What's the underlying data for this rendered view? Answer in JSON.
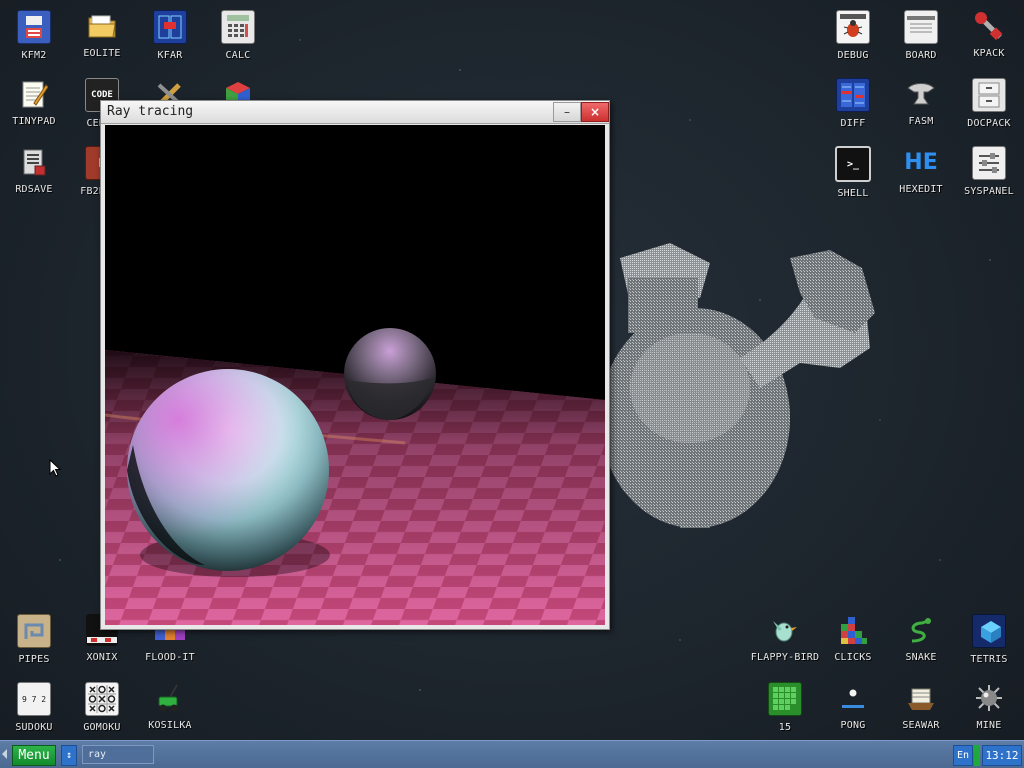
{
  "desktop": {
    "icons_left": [
      {
        "label": "KFM2",
        "icon": "floppy-disk-icon"
      },
      {
        "label": "EOLITE",
        "icon": "folder-icon"
      },
      {
        "label": "KFAR",
        "icon": "file-manager-icon"
      },
      {
        "label": "CALC",
        "icon": "calculator-icon"
      },
      {
        "label": "TINYPAD",
        "icon": "notepad-icon"
      },
      {
        "label": "CEDIT",
        "icon": "code-editor-icon"
      },
      {
        "label": "",
        "icon": "tools-icon"
      },
      {
        "label": "",
        "icon": "cube-icon"
      },
      {
        "label": "RDSAVE",
        "icon": "ramdisk-save-icon"
      },
      {
        "label": "FB2READ",
        "icon": "book-icon"
      }
    ],
    "icons_right": [
      {
        "label": "DEBUG",
        "icon": "bug-icon"
      },
      {
        "label": "BOARD",
        "icon": "board-icon"
      },
      {
        "label": "KPACK",
        "icon": "wrench-icon"
      },
      {
        "label": "DIFF",
        "icon": "diff-icon"
      },
      {
        "label": "FASM",
        "icon": "anvil-icon"
      },
      {
        "label": "DOCPACK",
        "icon": "cabinet-icon"
      },
      {
        "label": "SHELL",
        "icon": "terminal-icon"
      },
      {
        "label": "HEXEDIT",
        "icon": "hex-icon"
      },
      {
        "label": "SYSPANEL",
        "icon": "sliders-icon"
      }
    ],
    "icons_bottom_left": [
      {
        "label": "PIPES",
        "icon": "pipes-icon"
      },
      {
        "label": "XONIX",
        "icon": "xonix-icon"
      },
      {
        "label": "FLOOD-IT",
        "icon": "flood-icon"
      },
      {
        "label": "SUDOKU",
        "icon": "sudoku-icon"
      },
      {
        "label": "GOMOKU",
        "icon": "gomoku-icon"
      },
      {
        "label": "KOSILKA",
        "icon": "lawnmower-icon"
      }
    ],
    "icons_bottom_right": [
      {
        "label": "FLAPPY-BIRD",
        "icon": "bird-icon"
      },
      {
        "label": "CLICKS",
        "icon": "blocks-icon"
      },
      {
        "label": "SNAKE",
        "icon": "snake-icon"
      },
      {
        "label": "TETRIS",
        "icon": "tetris-icon"
      },
      {
        "label": "15",
        "icon": "fifteen-icon"
      },
      {
        "label": "PONG",
        "icon": "pong-icon"
      },
      {
        "label": "SEAWAR",
        "icon": "ship-icon"
      },
      {
        "label": "MINE",
        "icon": "mine-icon"
      }
    ],
    "sudoku_digits": "9 7 2",
    "code_badge": "CODE",
    "hex_badge": "HE"
  },
  "window": {
    "title": "Ray tracing",
    "minimize_glyph": "–",
    "close_glyph": "×"
  },
  "taskbar": {
    "menu_label": "Menu",
    "arrows_glyph": "↕",
    "task_label": "ray",
    "lang": "En",
    "clock": "13:12"
  },
  "colors": {
    "taskbar": "#4a6890",
    "menu_green": "#1a9a34",
    "close_red": "#d93a3a",
    "floor_pink": "#d0487e"
  }
}
